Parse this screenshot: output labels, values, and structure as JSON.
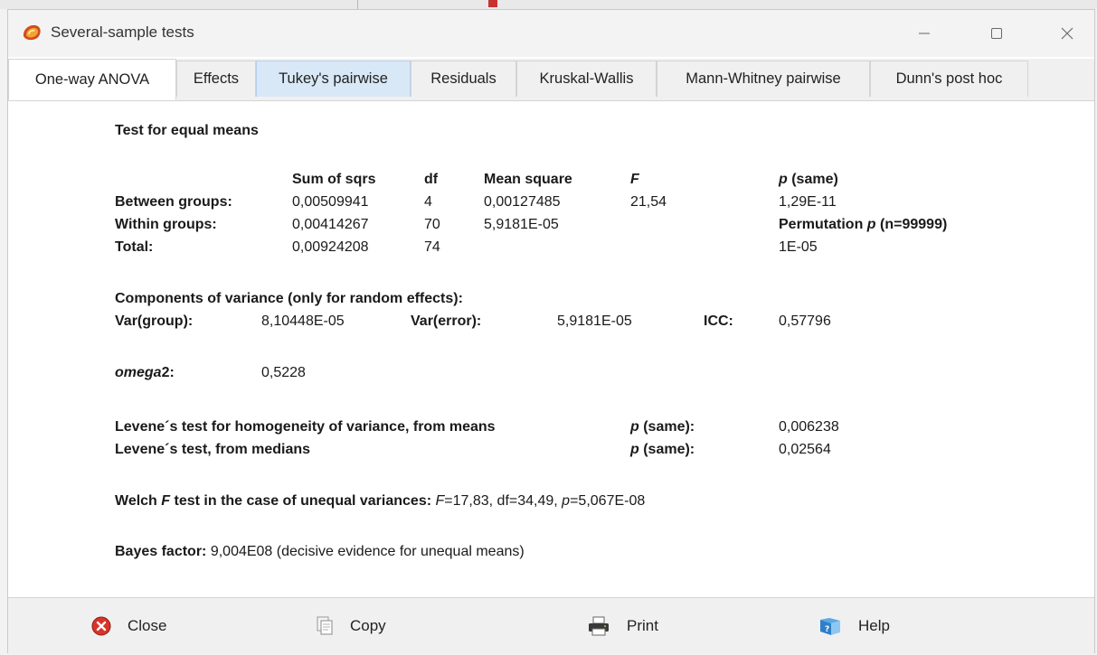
{
  "window": {
    "title": "Several-sample tests",
    "controls": {
      "minimize": "minimize",
      "maximize": "maximize",
      "close": "close"
    }
  },
  "tabs": [
    {
      "label": "One-way ANOVA",
      "state": "active"
    },
    {
      "label": "Effects",
      "state": "normal"
    },
    {
      "label": "Tukey's pairwise",
      "state": "hover"
    },
    {
      "label": "Residuals",
      "state": "normal"
    },
    {
      "label": "Kruskal-Wallis",
      "state": "normal"
    },
    {
      "label": "Mann-Whitney pairwise",
      "state": "normal"
    },
    {
      "label": "Dunn's post hoc",
      "state": "normal"
    }
  ],
  "anova": {
    "heading": "Test for equal means",
    "headers": {
      "ss": "Sum of sqrs",
      "df": "df",
      "ms": "Mean square",
      "f": "F",
      "p": "p",
      "p_suffix": " (same)"
    },
    "rows": [
      {
        "label": "Between groups:",
        "ss": "0,00509941",
        "df": "4",
        "ms": "0,00127485",
        "f": "21,54",
        "p": "1,29E-11"
      },
      {
        "label": "Within groups:",
        "ss": "0,00414267",
        "df": "70",
        "ms": "5,9181E-05",
        "f": "",
        "p": ""
      },
      {
        "label": "Total:",
        "ss": "0,00924208",
        "df": "74",
        "ms": "",
        "f": "",
        "p": "1E-05"
      }
    ],
    "permutation": {
      "prefix": "Permutation ",
      "p": "p",
      "suffix": " (n=99999)"
    }
  },
  "components": {
    "heading": "Components of variance (only for random effects):",
    "var_group_label": "Var(group):",
    "var_group": "8,10448E-05",
    "var_error_label": "Var(error):",
    "var_error": "5,9181E-05",
    "icc_label": "ICC:",
    "icc": "0,57796"
  },
  "omega": {
    "label": "omega",
    "sup": "2",
    "colon": ":",
    "value": "0,5228"
  },
  "levene": {
    "means_label": "Levene´s test for homogeneity of variance, from means",
    "means_p_label": "p",
    "means_p_suffix": " (same):",
    "means_value": "0,006238",
    "medians_label": "Levene´s test, from medians",
    "medians_p_label": "p",
    "medians_p_suffix": " (same):",
    "medians_value": "0,02564"
  },
  "welch": {
    "label_pre": "Welch ",
    "label_f": "F",
    "label_post": " test in the case of unequal variances:",
    "f_sym": "F",
    "f_val": "=17,83, df=34,49, ",
    "p_sym": "p",
    "p_val": "=5,067E-08"
  },
  "bayes": {
    "label": "Bayes factor:",
    "value": " 9,004E08 (decisive evidence for unequal means)"
  },
  "footer": {
    "close": "Close",
    "copy": "Copy",
    "print": "Print",
    "help": "Help"
  }
}
